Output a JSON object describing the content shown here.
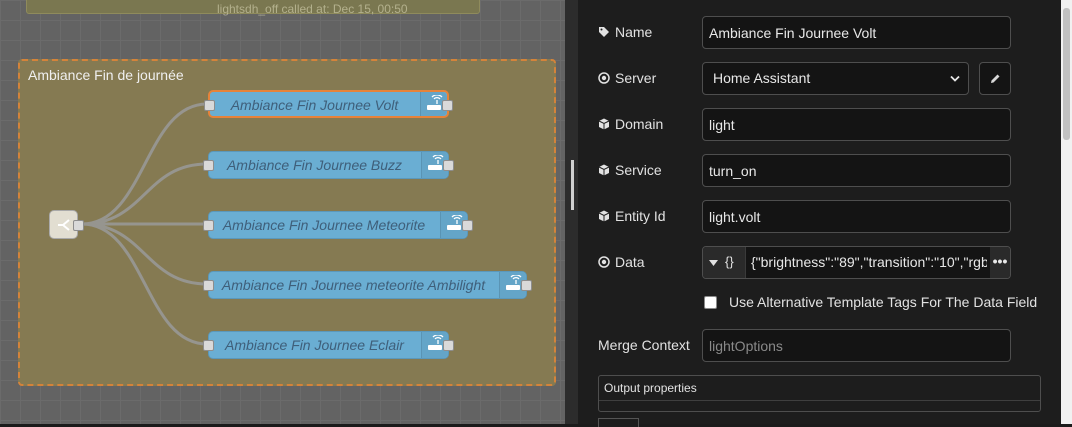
{
  "canvas": {
    "previous_group_label": "lightsdh_off called at: Dec 15, 00:50",
    "group_label": "Ambiance Fin de journée",
    "nodes": [
      {
        "label": "Ambiance Fin Journee Volt",
        "selected": true
      },
      {
        "label": "Ambiance Fin Journee Buzz",
        "selected": false
      },
      {
        "label": "Ambiance Fin Journee Meteorite",
        "selected": false
      },
      {
        "label": "Ambiance Fin Journee meteorite Ambilight",
        "selected": false
      },
      {
        "label": "Ambiance Fin Journee Eclair",
        "selected": false
      }
    ],
    "node_color": "#6aaed3",
    "group_border_color": "#d4833a",
    "source_node_icon": "switch-icon",
    "action_node_icon": "router-icon"
  },
  "panel": {
    "name": {
      "label": "Name",
      "icon": "tag-icon",
      "value": "Ambiance Fin Journee Volt"
    },
    "server": {
      "label": "Server",
      "icon": "dot-circle-icon",
      "value": "Home Assistant",
      "edit_icon": "pencil-icon"
    },
    "domain": {
      "label": "Domain",
      "icon": "cube-icon",
      "value": "light"
    },
    "service": {
      "label": "Service",
      "icon": "cube-icon",
      "value": "turn_on"
    },
    "entity_id": {
      "label": "Entity Id",
      "icon": "cube-icon",
      "value": "light.volt"
    },
    "data": {
      "label": "Data",
      "icon": "dot-circle-icon",
      "type_label": "{}",
      "value": "{\"brightness\":\"89\",\"transition\":\"10\",\"rgb_",
      "expand_label": "•••"
    },
    "alt_template": {
      "label": "Use Alternative Template Tags For The Data Field",
      "checked": false
    },
    "merge_context": {
      "label": "Merge Context",
      "placeholder": "lightOptions",
      "value": ""
    },
    "output_properties": {
      "title": "Output properties"
    }
  }
}
